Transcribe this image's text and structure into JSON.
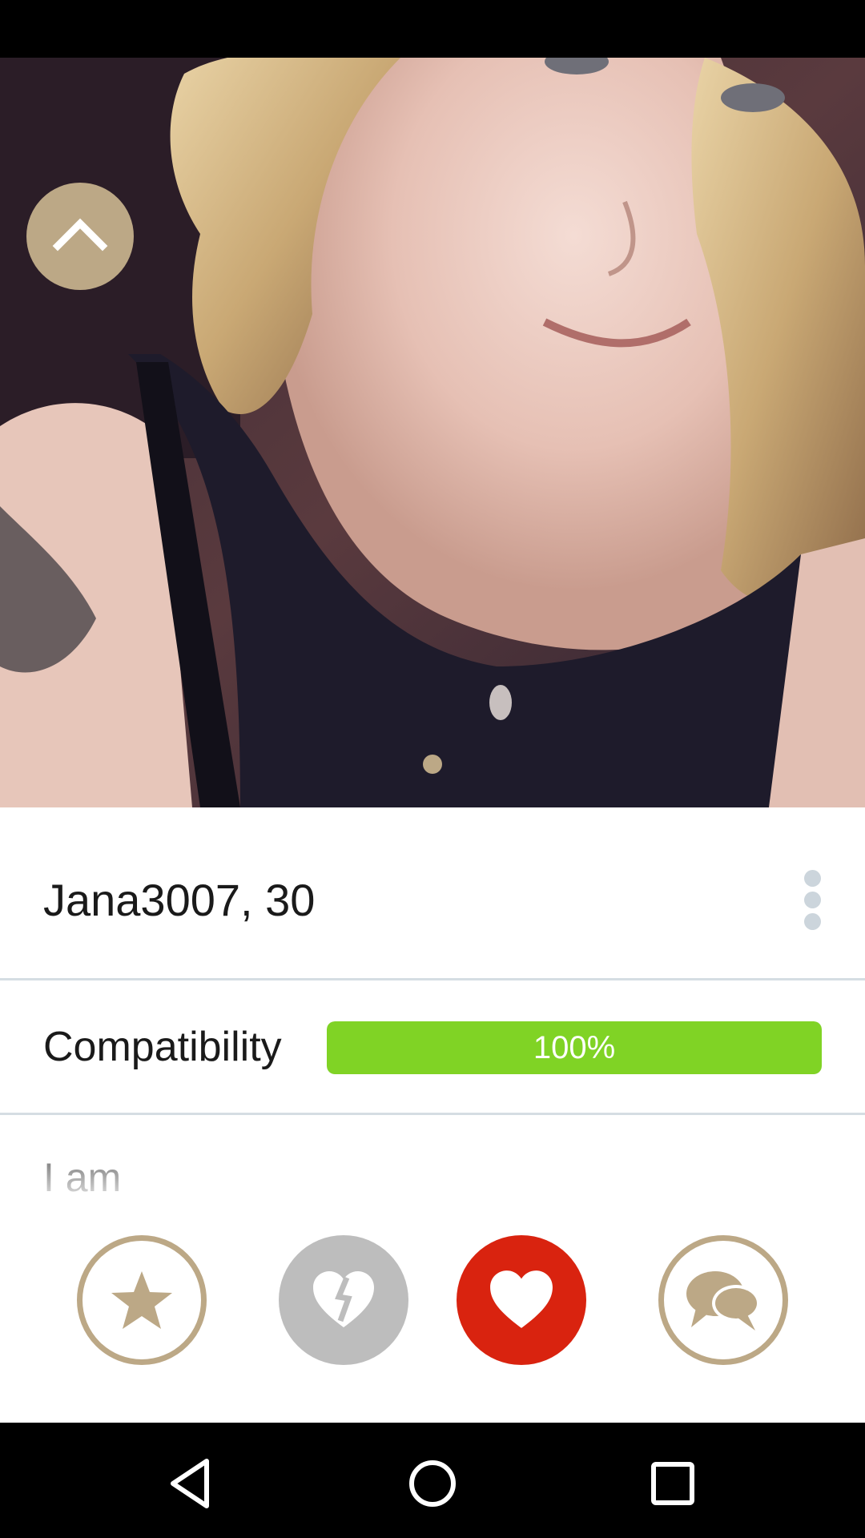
{
  "profile": {
    "name_age": "Jana3007, 30"
  },
  "compatibility": {
    "label": "Compatibility",
    "value_label": "100%",
    "percent": 100,
    "fill_color": "#80d325"
  },
  "about": {
    "heading": "I am"
  },
  "colors": {
    "accent": "#bca886",
    "like": "#d9230f",
    "dislike": "#bdbdbd",
    "divider": "#d5dde3"
  },
  "icons": {
    "up": "chevron-up-icon",
    "more": "more-vertical-icon",
    "favorite": "star-icon",
    "dislike": "broken-heart-icon",
    "like": "heart-icon",
    "chat": "chat-bubbles-icon",
    "nav_back": "back-triangle-icon",
    "nav_home": "home-circle-icon",
    "nav_recents": "recents-square-icon"
  },
  "photo": {
    "page_count": 1,
    "current_page": 1
  }
}
